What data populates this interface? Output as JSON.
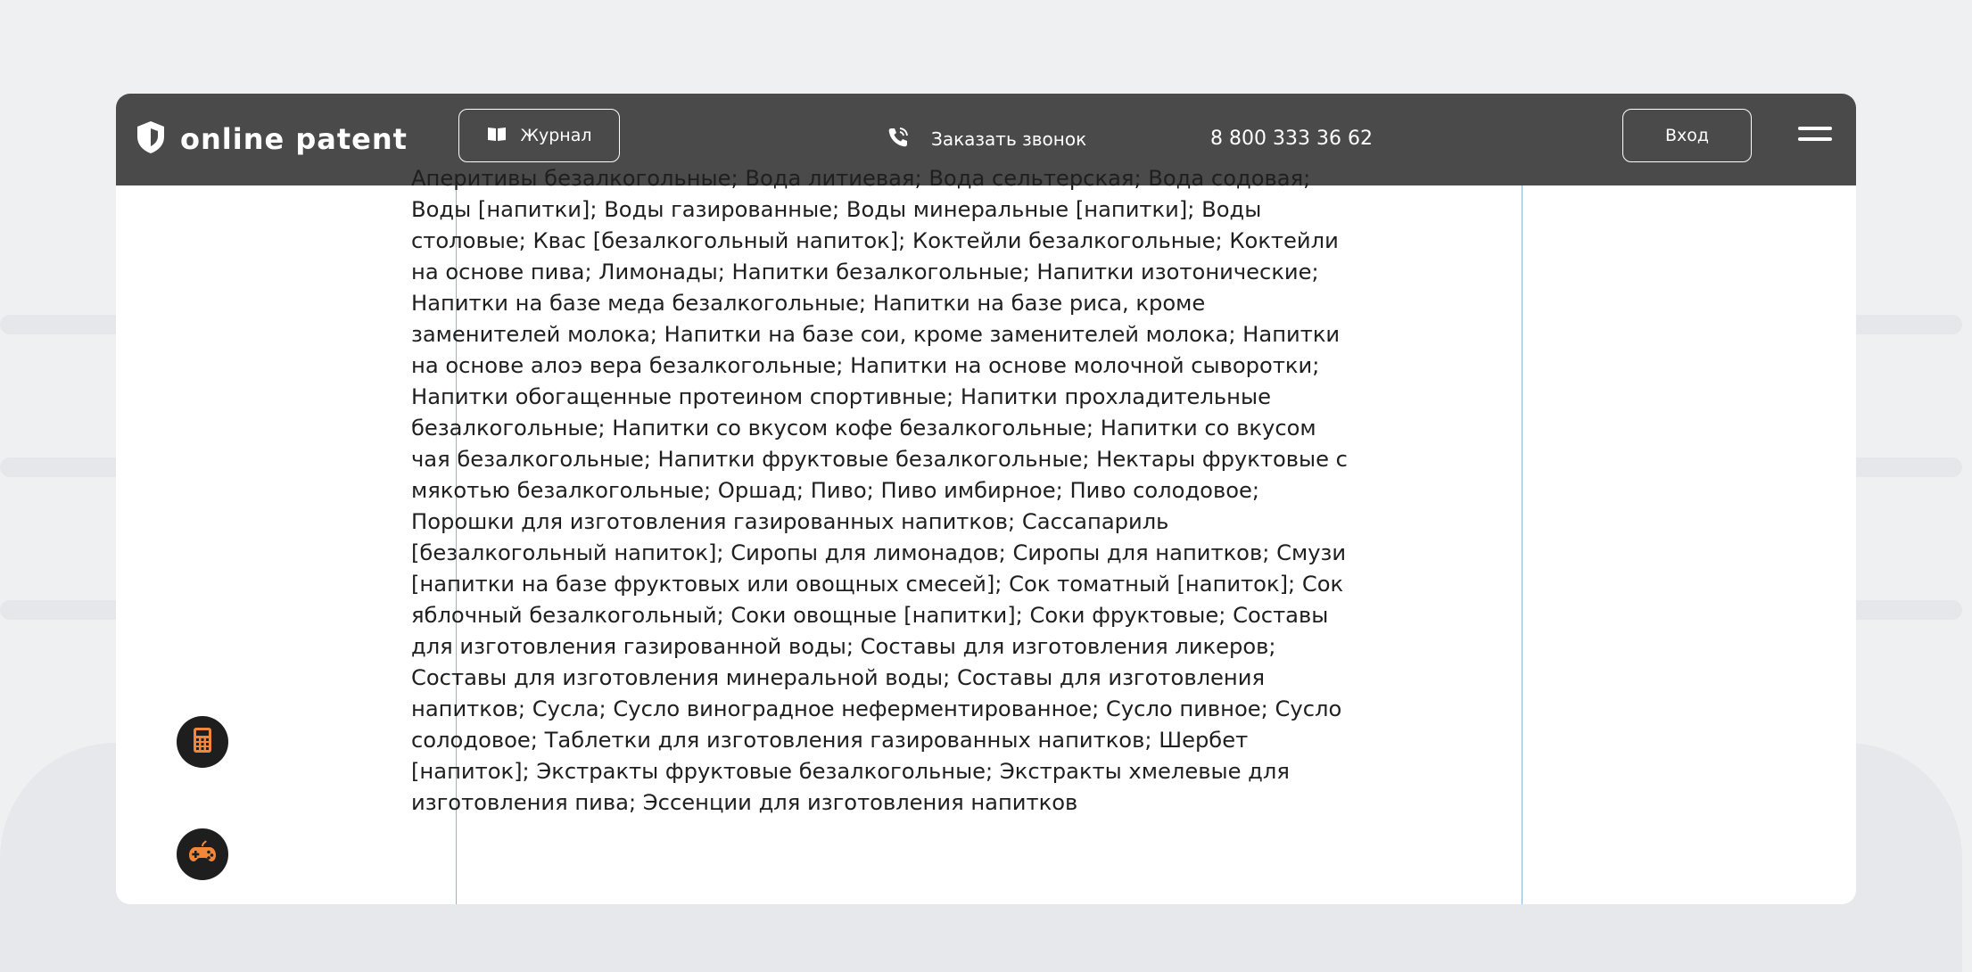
{
  "header": {
    "brand": "online patent",
    "journal_label": "Журнал",
    "callback_label": "Заказать звонок",
    "phone": "8 800 333 36 62",
    "login_label": "Вход"
  },
  "content": {
    "text": "Аперитивы безалкогольные; Вода литиевая; Вода сельтерская; Вода содовая; Воды [напитки]; Воды газированные; Воды минеральные [напитки]; Воды столовые; Квас [безалкогольный напиток]; Коктейли безалкогольные; Коктейли на основе пива; Лимонады; Напитки безалкогольные; Напитки изотонические; Напитки на базе меда безалкогольные; Напитки на базе риса, кроме заменителей молока; Напитки на базе сои, кроме заменителей молока; Напитки на основе алоэ вера безалкогольные; Напитки на основе молочной сыворотки; Напитки обогащенные протеином спортивные; Напитки прохладительные безалкогольные; Напитки со вкусом кофе безалкогольные; Напитки со вкусом чая безалкогольные; Напитки фруктовые безалкогольные; Нектары фруктовые с мякотью безалкогольные; Оршад; Пиво; Пиво имбирное; Пиво солодовое; Порошки для изготовления газированных напитков; Сассапариль [безалкогольный напиток]; Сиропы для лимонадов; Сиропы для напитков; Смузи [напитки на базе фруктовых или овощных смесей]; Сок томатный [напиток]; Сок яблочный безалкогольный; Соки овощные [напитки]; Соки фруктовые; Составы для изготовления газированной воды; Составы для изготовления ликеров; Составы для изготовления минеральной воды; Составы для изготовления напитков; Сусла; Сусло виноградное неферментированное; Сусло пивное; Сусло солодовое; Таблетки для изготовления газированных напитков; Шербет [напиток]; Экстракты фруктовые безалкогольные; Экстракты хмелевые для изготовления пива; Эссенции для изготовления напитков"
  },
  "icons": {
    "logo": "shield-icon",
    "journal": "book-icon",
    "callback": "phone-icon",
    "menu": "hamburger-menu-icon",
    "fab_1": "calculator-icon",
    "fab_2": "gamepad-icon"
  },
  "colors": {
    "header_bg": "#4a4a4a",
    "page_bg": "#eff0f2",
    "fab_bg": "#1e1e1e",
    "fab_accent": "#f2873a",
    "column_border": "#8eb6d6"
  }
}
